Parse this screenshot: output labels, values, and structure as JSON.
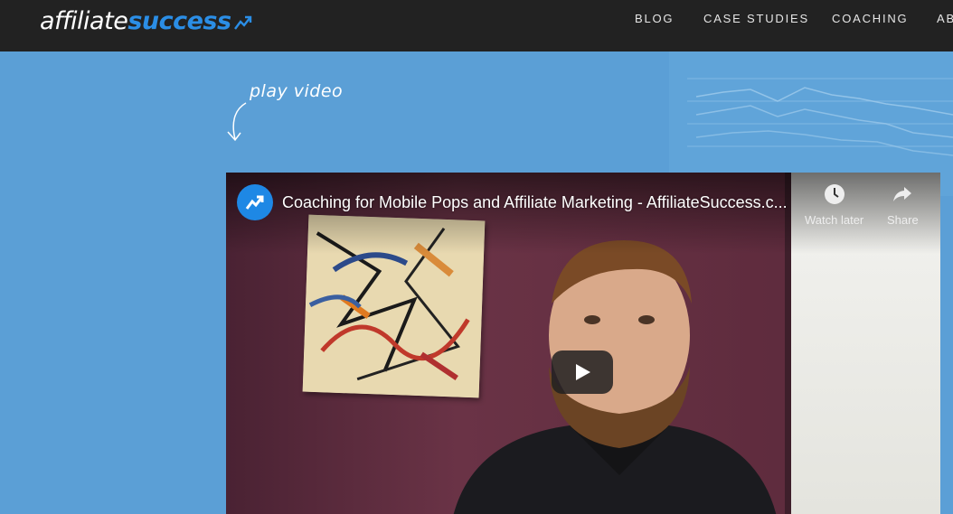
{
  "header": {
    "logo_part1": "affiliate",
    "logo_part2": "success",
    "nav": [
      {
        "label": "BLOG"
      },
      {
        "label": "CASE STUDIES"
      },
      {
        "label": "COACHING"
      },
      {
        "label": "AB"
      }
    ]
  },
  "hero": {
    "play_hint": "play video"
  },
  "video": {
    "title": "Coaching for Mobile Pops and Affiliate Marketing - AffiliateSuccess.c...",
    "watch_later": "Watch later",
    "share": "Share"
  },
  "colors": {
    "background": "#5b9fd6",
    "header": "#222222",
    "logo_accent": "#2b8ee6",
    "avatar": "#1e88e5"
  },
  "icons": {
    "logo": "trend-up-icon",
    "watch_later": "clock-icon",
    "share": "share-arrow-icon",
    "play": "play-icon",
    "hint": "curved-arrow-icon"
  }
}
